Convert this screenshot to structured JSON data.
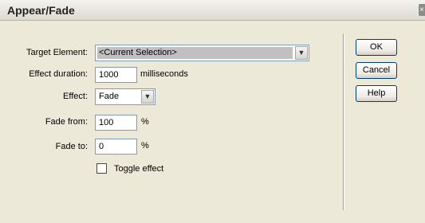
{
  "window": {
    "title": "Appear/Fade"
  },
  "form": {
    "target_element": {
      "label": "Target Element:",
      "value": "<Current Selection>"
    },
    "effect_duration": {
      "label": "Effect duration:",
      "value": "1000",
      "unit": "milliseconds"
    },
    "effect": {
      "label": "Effect:",
      "value": "Fade"
    },
    "fade_from": {
      "label": "Fade from:",
      "value": "100",
      "unit": "%"
    },
    "fade_to": {
      "label": "Fade to:",
      "value": "0",
      "unit": "%"
    },
    "toggle_effect": {
      "label": "Toggle effect",
      "checked": false
    }
  },
  "buttons": {
    "ok": "OK",
    "cancel": "Cancel",
    "help": "Help"
  },
  "icons": {
    "dropdown": "chevron-down-icon",
    "close": "close-icon"
  }
}
